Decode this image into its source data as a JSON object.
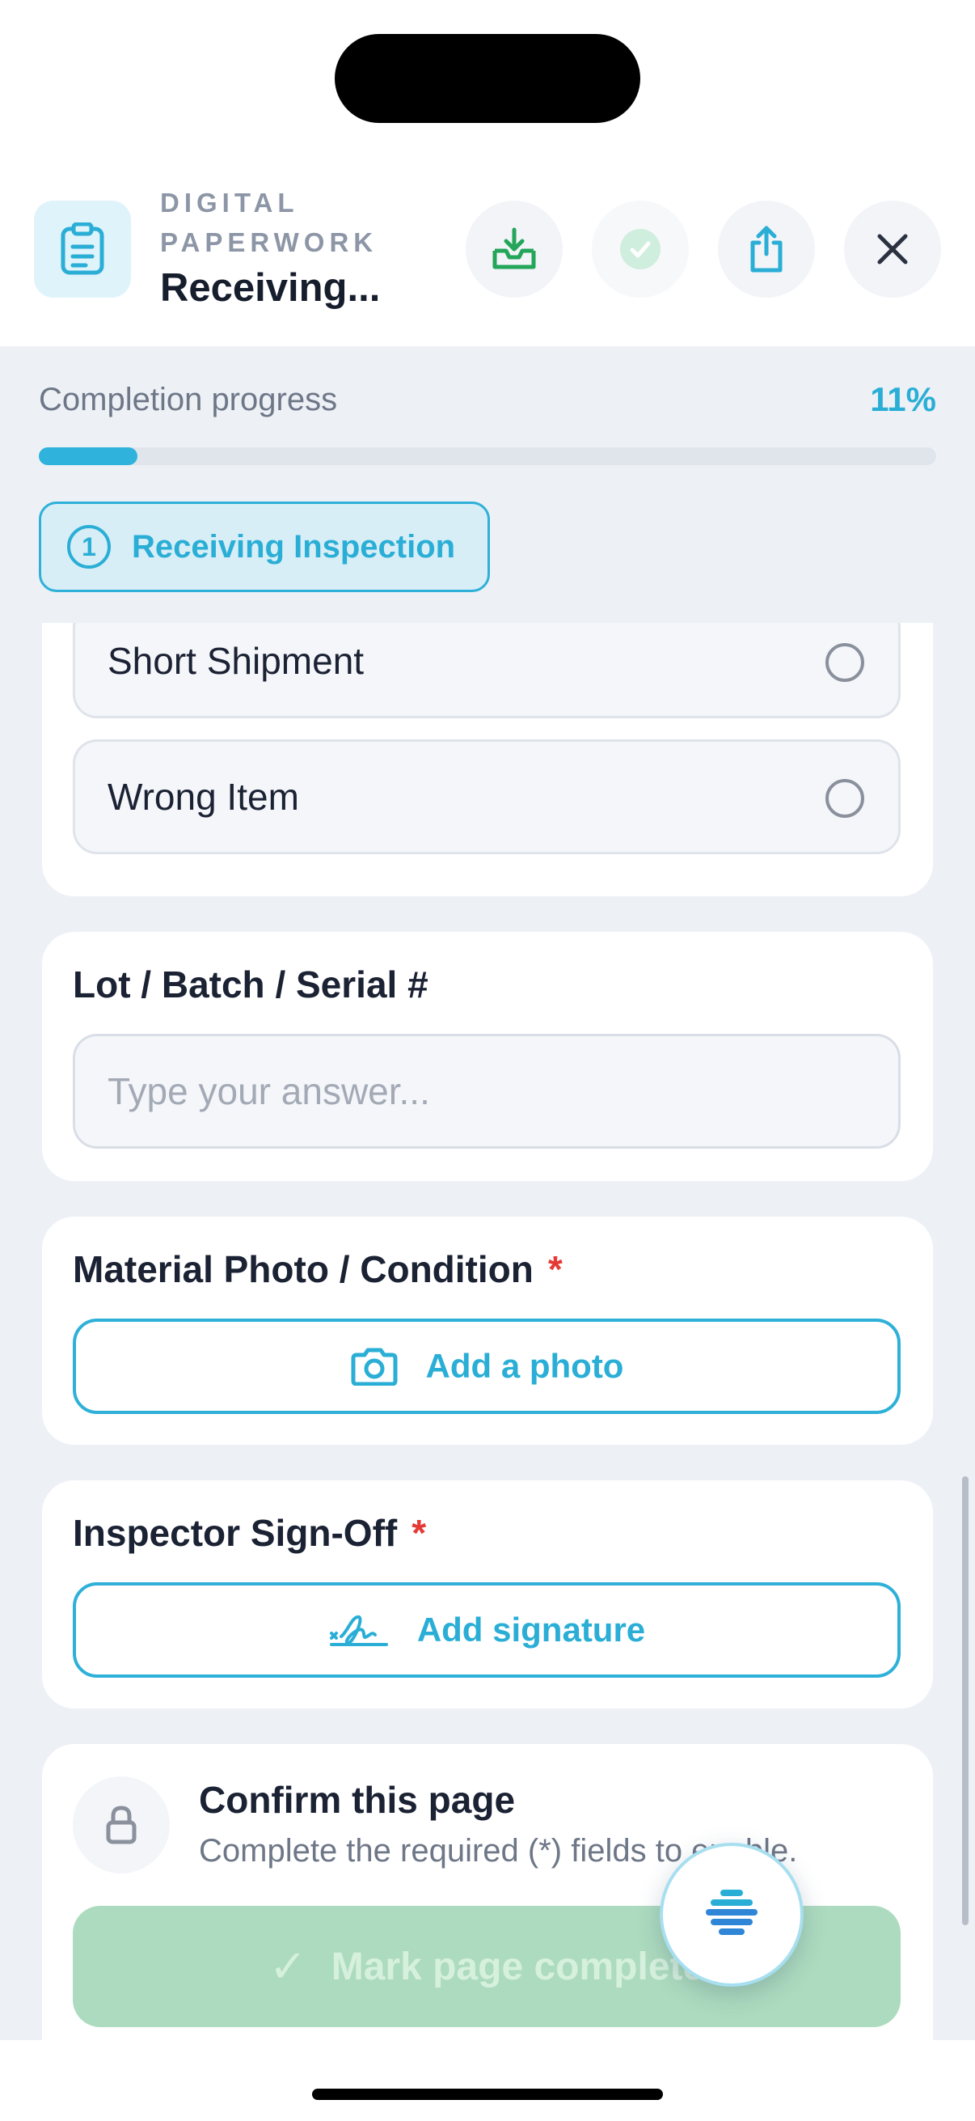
{
  "header": {
    "eyebrow": "DIGITAL PAPERWORK",
    "title": "Receiving...",
    "icons": [
      "clipboard-icon",
      "inbox-download-icon",
      "check-circle-icon",
      "share-icon",
      "close-icon"
    ]
  },
  "progress": {
    "label": "Completion progress",
    "percent_text": "11%",
    "value": 0.11
  },
  "section_chip": {
    "number": "1",
    "label": "Receiving Inspection"
  },
  "options": [
    {
      "label": "Short Shipment",
      "selected": false
    },
    {
      "label": "Wrong Item",
      "selected": false
    }
  ],
  "lot_field": {
    "label": "Lot / Batch / Serial #",
    "placeholder": "Type your answer...",
    "value": ""
  },
  "photo_field": {
    "label": "Material Photo / Condition",
    "required_mark": "*",
    "button_label": "Add a photo"
  },
  "signature_field": {
    "label": "Inspector Sign-Off",
    "required_mark": "*",
    "button_label": "Add signature"
  },
  "confirm": {
    "title": "Confirm this page",
    "subtitle": "Complete the required (*) fields to enable.",
    "button_label": "Mark page complete",
    "button_icon": "check-icon"
  },
  "colors": {
    "accent": "#2aaed6",
    "required": "#e53935",
    "disabled_button": "#addbbf",
    "download_icon": "#23a55a"
  }
}
